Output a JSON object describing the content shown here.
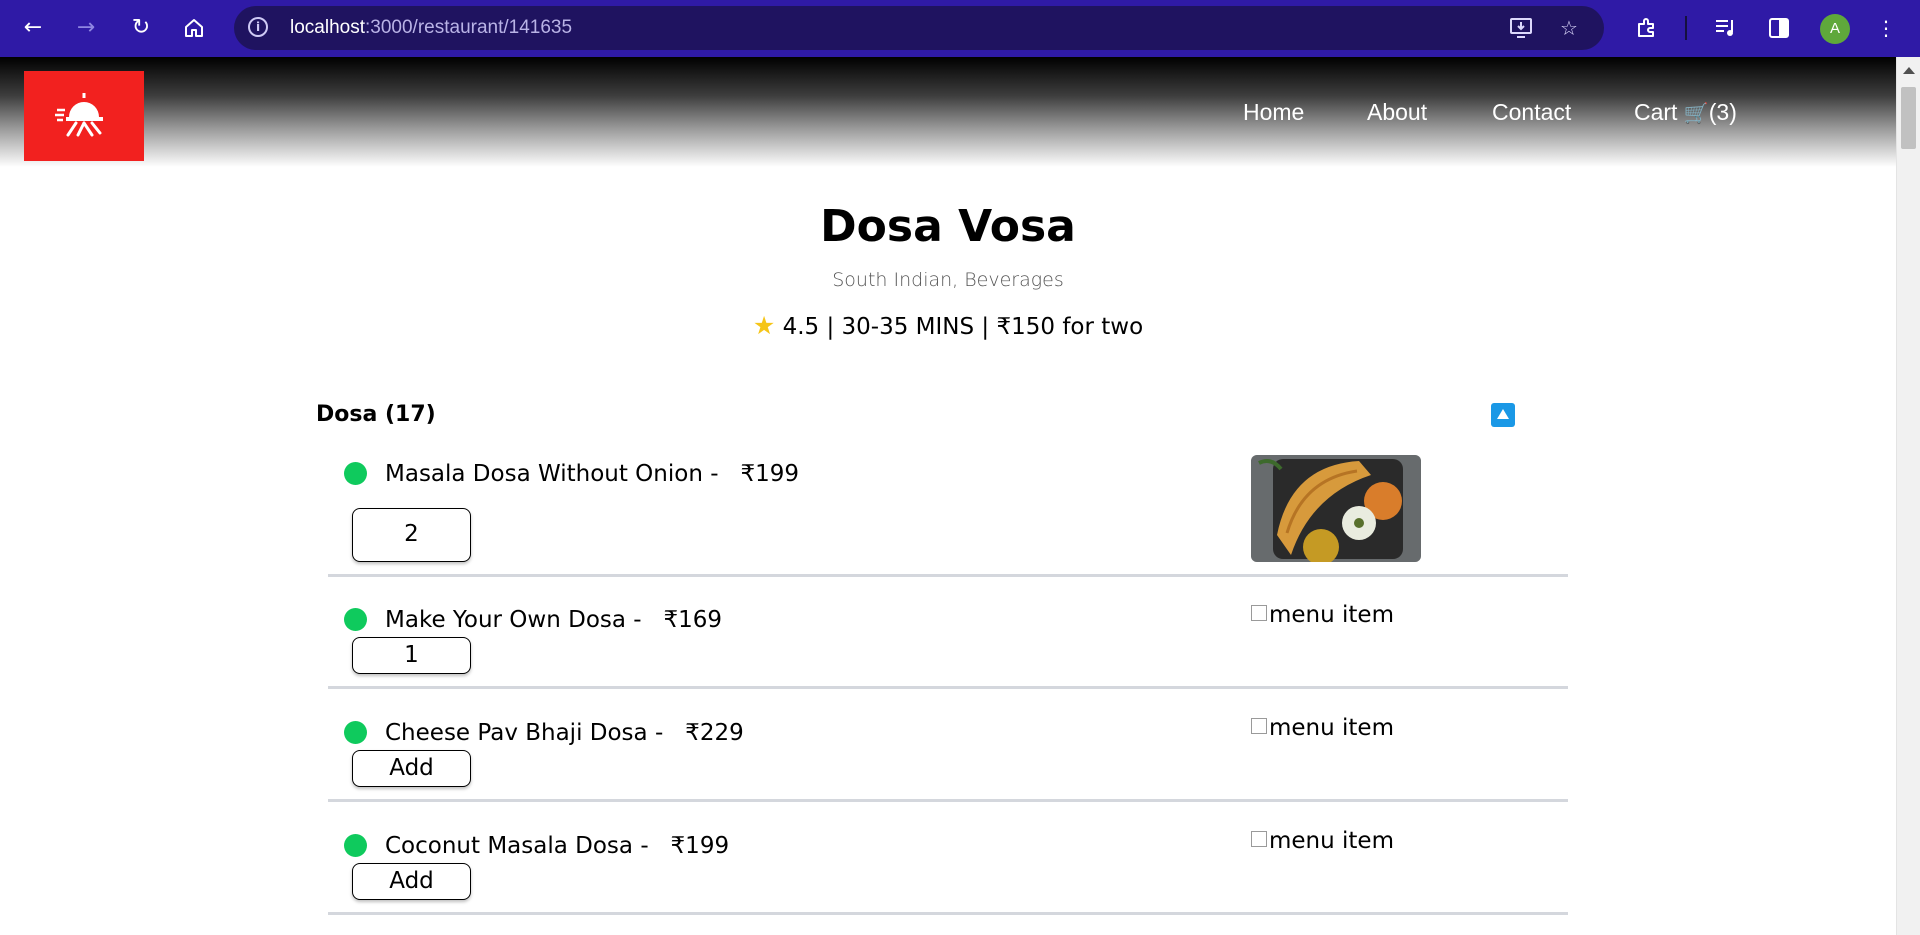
{
  "browser": {
    "url_host": "localhost",
    "url_path": ":3000/restaurant/141635",
    "profile_initial": "A",
    "icons": [
      "back-arrow-icon",
      "forward-arrow-icon",
      "reload-icon",
      "home-icon",
      "site-info-icon",
      "install-app-icon",
      "bookmark-star-icon",
      "extensions-icon",
      "media-controls-icon",
      "side-panel-icon",
      "more-menu-icon"
    ]
  },
  "header": {
    "logo_alt": "food delivery logo",
    "nav": {
      "home": "Home",
      "about": "About",
      "contact": "Contact",
      "cart": "Cart",
      "cart_icon": "🛒",
      "cart_count": "(3)"
    }
  },
  "restaurant": {
    "name": "Dosa Vosa",
    "cuisines": "South Indian, Beverages",
    "rating": "4.5",
    "delivery_time": "30-35 MINS",
    "cost_for_two": "₹150 for two",
    "separator": "|"
  },
  "menu": {
    "category": "Dosa (17)",
    "items": [
      {
        "name": "Masala Dosa Without Onion -   ₹199",
        "button": "2",
        "image": "photo",
        "veg": true
      },
      {
        "name": "Make Your Own Dosa -   ₹169",
        "button": "1",
        "image_alt": "menu item",
        "veg": true
      },
      {
        "name": "Cheese Pav Bhaji Dosa -   ₹229",
        "button": "Add",
        "image_alt": "menu item",
        "veg": true
      },
      {
        "name": "Coconut Masala Dosa -   ₹199",
        "button": "Add",
        "image_alt": "menu item",
        "veg": true
      }
    ]
  },
  "colors": {
    "browser_bar": "#2f1aa6",
    "logo_bg": "#f2211f",
    "veg_dot": "#0fca5d",
    "toggle_button": "#1a98e6",
    "star": "#f5c518"
  }
}
